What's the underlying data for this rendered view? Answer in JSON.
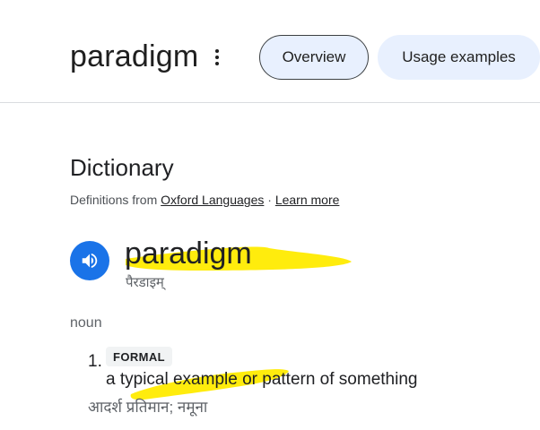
{
  "header": {
    "query": "paradigm",
    "more_icon": "more-vert-icon",
    "chips": [
      {
        "label": "Overview",
        "selected": true
      },
      {
        "label": "Usage examples",
        "selected": false
      }
    ]
  },
  "dictionary": {
    "title": "Dictionary",
    "source_prefix": "Definitions from ",
    "source_link": "Oxford Languages",
    "separator": " · ",
    "learn_more": "Learn more",
    "audio_icon": "speaker-icon",
    "word": "paradigm",
    "phonetic": "पैरडाइम्",
    "part_of_speech": "noun",
    "senses": [
      {
        "number": "1.",
        "label": "FORMAL",
        "definition": "a typical example or pattern of something",
        "translation": "आदर्श प्रतिमान; नमूना"
      }
    ]
  },
  "colors": {
    "accent": "#1a73e8",
    "chip_bg": "#e8f0fe",
    "highlight": "#ffeb00"
  }
}
